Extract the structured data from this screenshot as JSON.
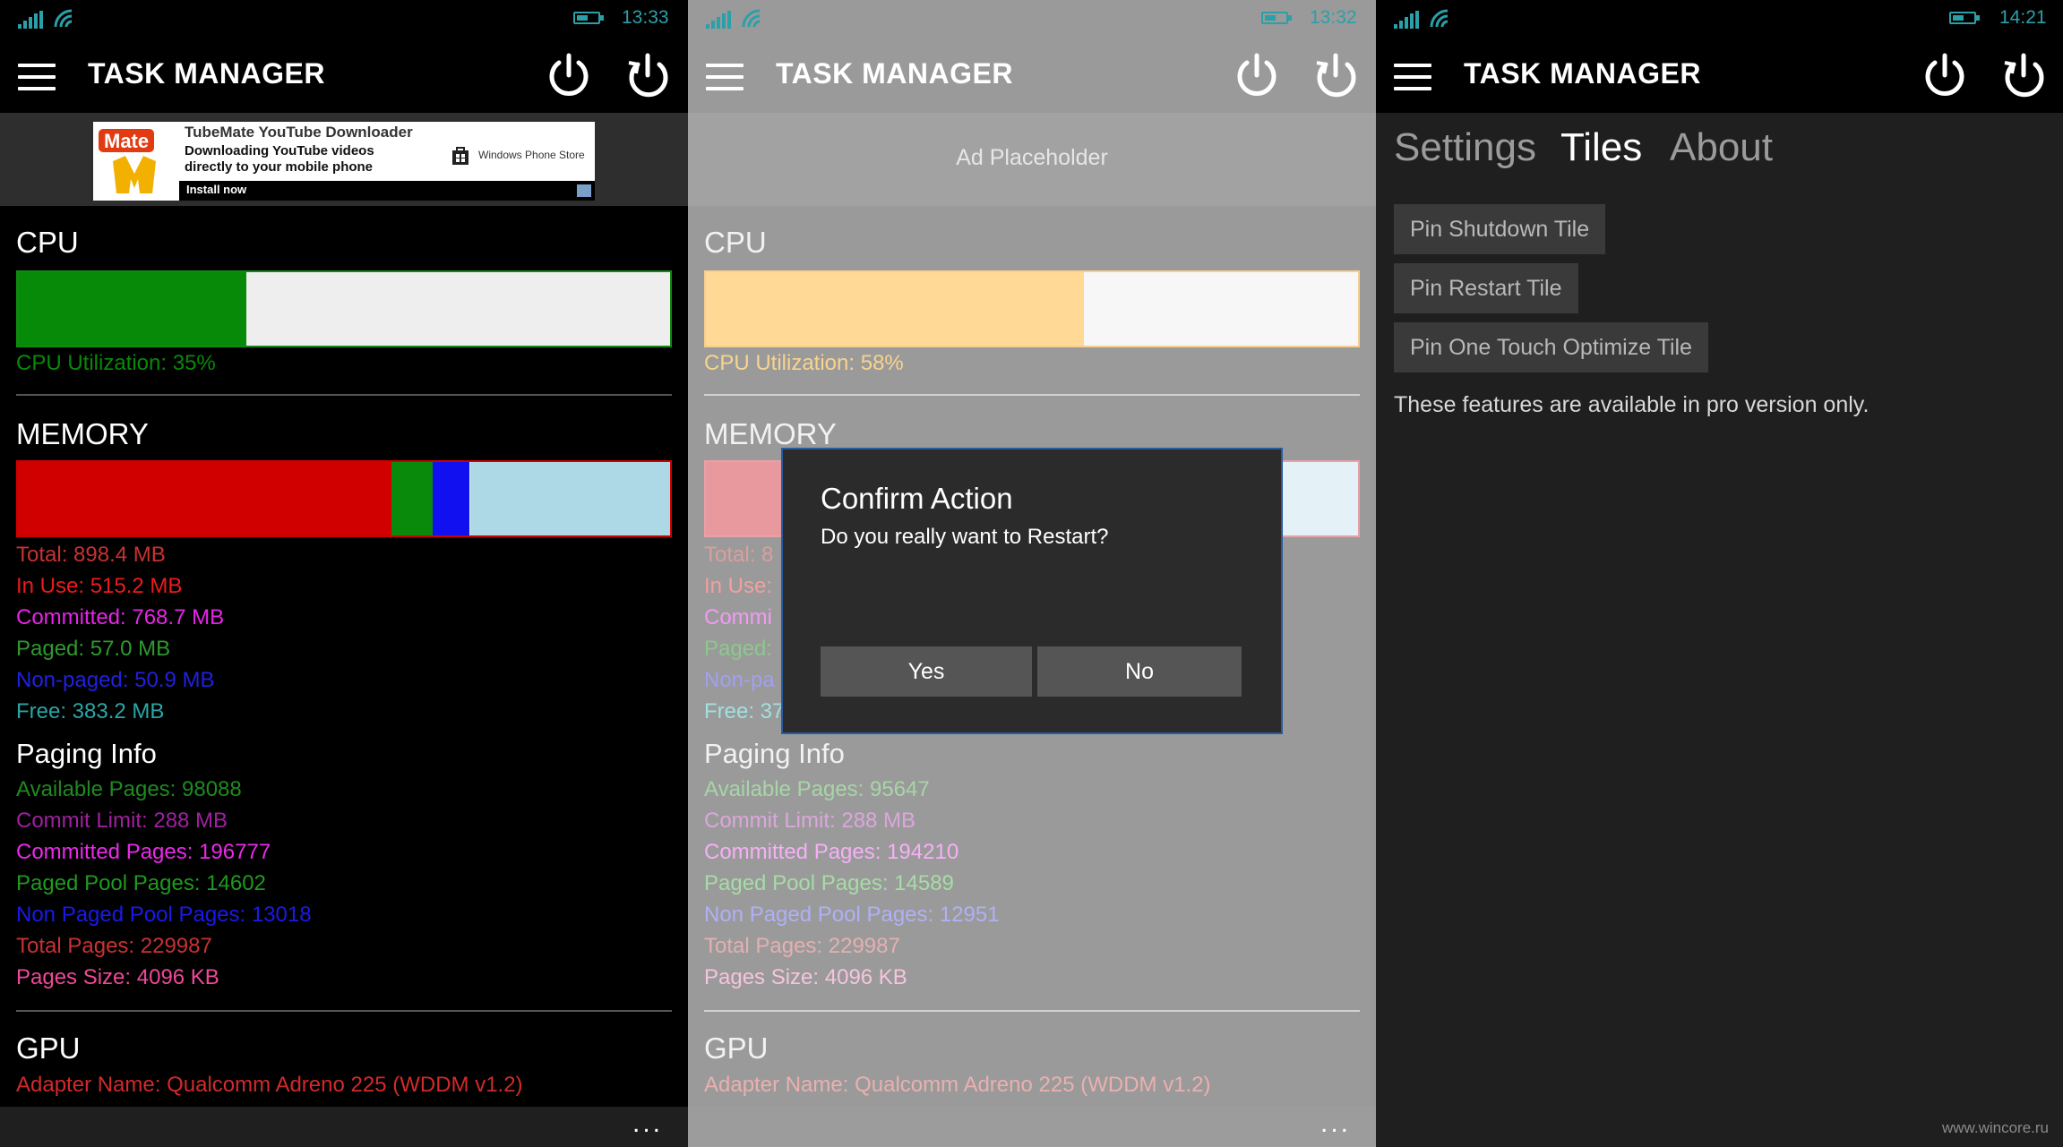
{
  "colors": {
    "accent": "#2ba0a8",
    "cpu_green": "#078a07",
    "memory_in_use": "#d10000",
    "memory_paged": "#0a8a0a",
    "memory_nonpaged": "#1010f0",
    "memory_free": "#add8e6",
    "cpu_highlight_dimmed": "#ffd995"
  },
  "icons": {
    "menu": "hamburger-icon",
    "power": "power-icon",
    "restart": "restart-icon",
    "signal": "signal-icon",
    "wifi": "wifi-icon",
    "battery": "battery-icon",
    "more": "more-icon",
    "store": "windows-store-icon"
  },
  "app": {
    "title": "TASK MANAGER"
  },
  "panel1": {
    "time": "13:33",
    "ad": {
      "title": "TubeMate YouTube Downloader",
      "line1": "Downloading YouTube videos",
      "line2": "directly to your mobile phone",
      "store": "Windows Phone Store",
      "install": "Install now",
      "logo_text": "Mate"
    },
    "cpu": {
      "title": "CPU",
      "utilization_label": "CPU Utilization: 35%",
      "utilization_percent": 35
    },
    "memory": {
      "title": "MEMORY",
      "bar_segments_percent": {
        "in_use": 57.3,
        "paged": 6.3,
        "nonpaged": 5.7,
        "free": 30.7
      },
      "lines": [
        "Total: 898.4 MB",
        "In Use: 515.2 MB",
        "Committed: 768.7 MB",
        "Paged: 57.0 MB",
        "Non-paged: 50.9 MB",
        "Free: 383.2 MB"
      ]
    },
    "paging": {
      "title": "Paging Info",
      "lines": [
        "Available Pages: 98088",
        "Commit Limit: 288 MB",
        "Committed Pages: 196777",
        "Paged Pool Pages: 14602",
        "Non Paged Pool Pages: 13018",
        "Total Pages: 229987",
        "Pages Size: 4096 KB"
      ]
    },
    "gpu": {
      "title": "GPU",
      "adapter": "Adapter Name: Qualcomm Adreno 225 (WDDM v1.2)"
    },
    "more_label": "..."
  },
  "panel2": {
    "time": "13:32",
    "ad_placeholder": "Ad Placeholder",
    "cpu": {
      "title": "CPU",
      "utilization_label": "CPU Utilization: 58%",
      "utilization_percent": 58
    },
    "memory": {
      "title": "MEMORY",
      "visible_lines": [
        "Total: 8",
        "In Use:",
        "Commi",
        "Paged:",
        "Non-pa",
        "Free: 37"
      ]
    },
    "paging": {
      "title": "Paging Info",
      "lines": [
        "Available Pages: 95647",
        "Commit Limit: 288 MB",
        "Committed Pages: 194210",
        "Paged Pool Pages: 14589",
        "Non Paged Pool Pages: 12951",
        "Total Pages: 229987",
        "Pages Size: 4096 KB"
      ]
    },
    "gpu": {
      "title": "GPU",
      "adapter": "Adapter Name: Qualcomm Adreno 225 (WDDM v1.2)"
    },
    "dialog": {
      "title": "Confirm Action",
      "message": "Do you really want to Restart?",
      "yes": "Yes",
      "no": "No"
    },
    "more_label": "..."
  },
  "panel3": {
    "time": "14:21",
    "pivot": {
      "settings": "Settings",
      "tiles": "Tiles",
      "about": "About",
      "selected": "Tiles"
    },
    "buttons": {
      "shutdown": "Pin Shutdown Tile",
      "restart": "Pin Restart Tile",
      "optimize": "Pin One Touch Optimize Tile"
    },
    "note": "These features are available in pro version only.",
    "watermark": "www.wincore.ru"
  }
}
